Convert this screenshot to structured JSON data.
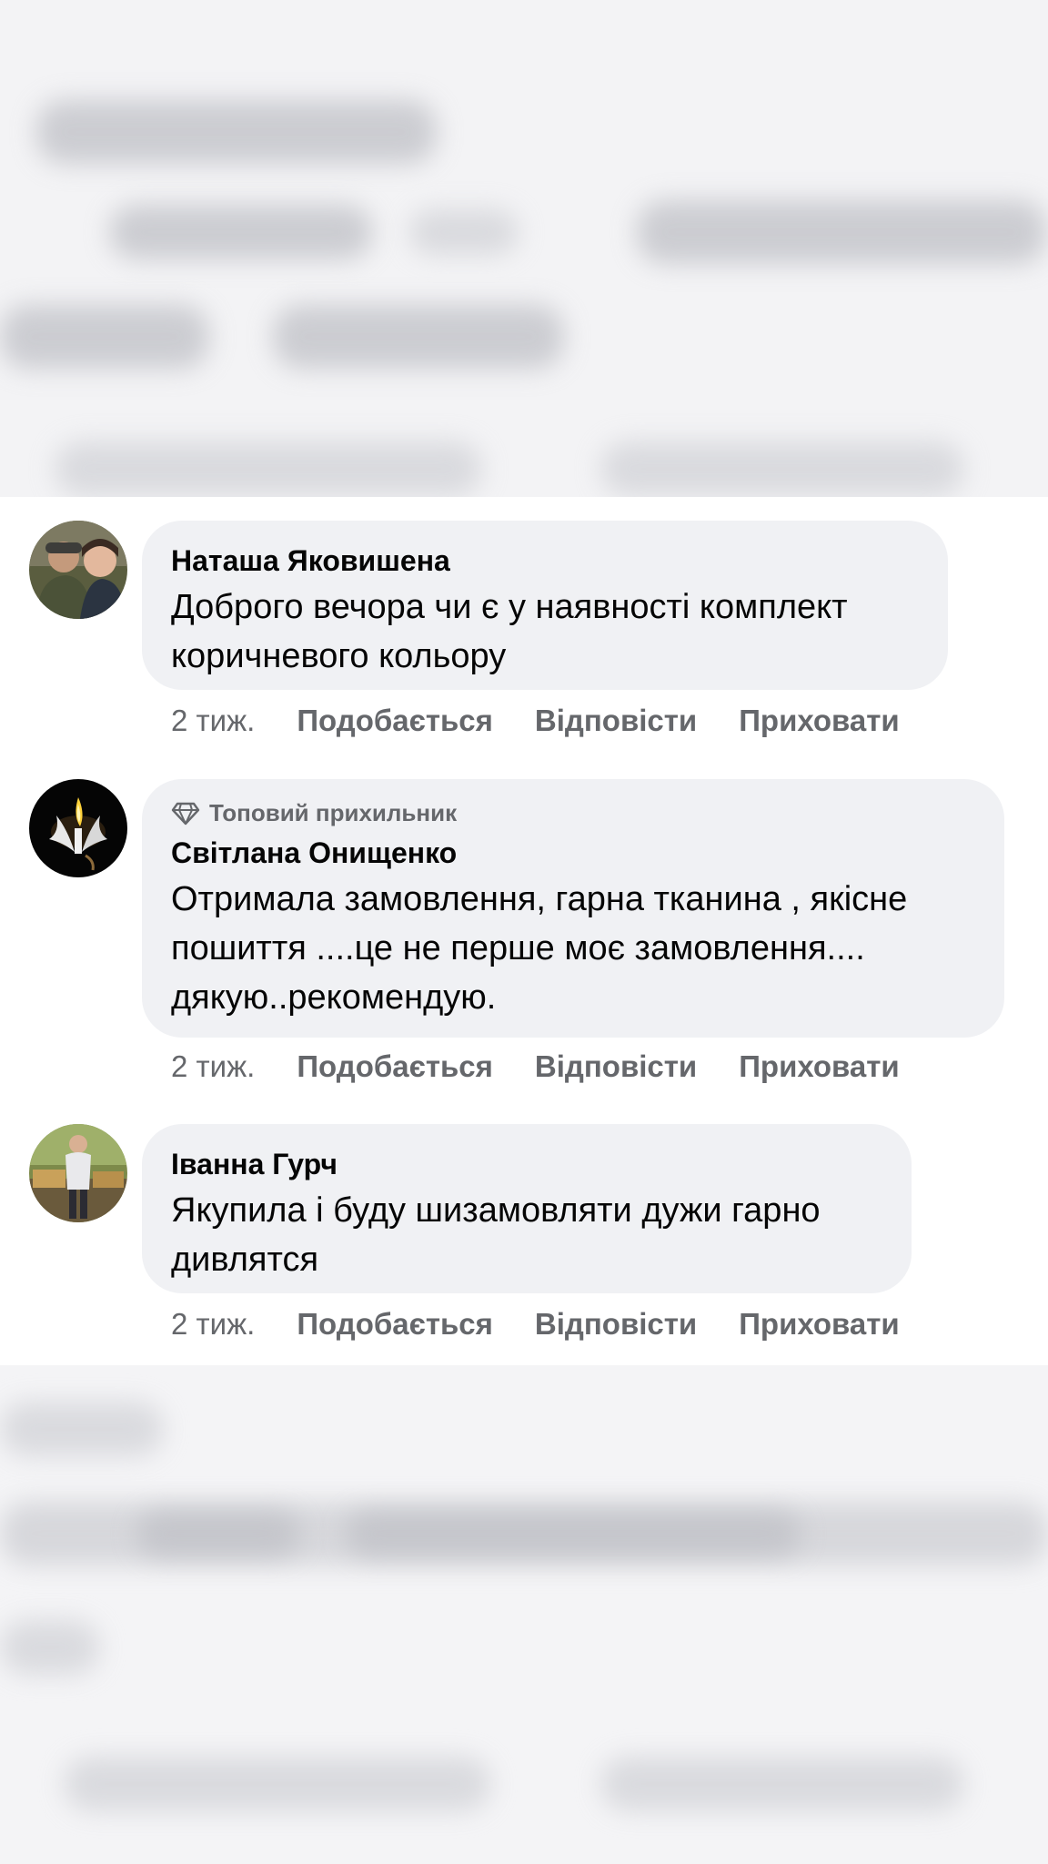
{
  "comments": [
    {
      "author": "Наташа Яковишена",
      "badge": "",
      "text": "Доброго вечора чи є у наявності комплект коричневого кольору",
      "time": "2 тиж.",
      "like": "Подобається",
      "reply": "Відповісти",
      "hide": "Приховати"
    },
    {
      "author": "Світлана Онищенко",
      "badge": "Топовий прихильник",
      "text": "Отримала замовлення, гарна тканина , якісне пошиття ....це не перше моє замовлення.... дякую..рекомендую.",
      "time": "2 тиж.",
      "like": "Подобається",
      "reply": "Відповісти",
      "hide": "Приховати"
    },
    {
      "author": "Іванна Гурч",
      "badge": "",
      "text": "Якупила і буду шизамовляти дужи гарно дивлятся",
      "time": "2 тиж.",
      "like": "Подобається",
      "reply": "Відповісти",
      "hide": "Приховати"
    }
  ],
  "icons": {
    "badge": "diamond-icon"
  },
  "colors": {
    "bubble": "#f0f1f4",
    "secondary_text": "#65676b",
    "primary_text": "#050505"
  }
}
